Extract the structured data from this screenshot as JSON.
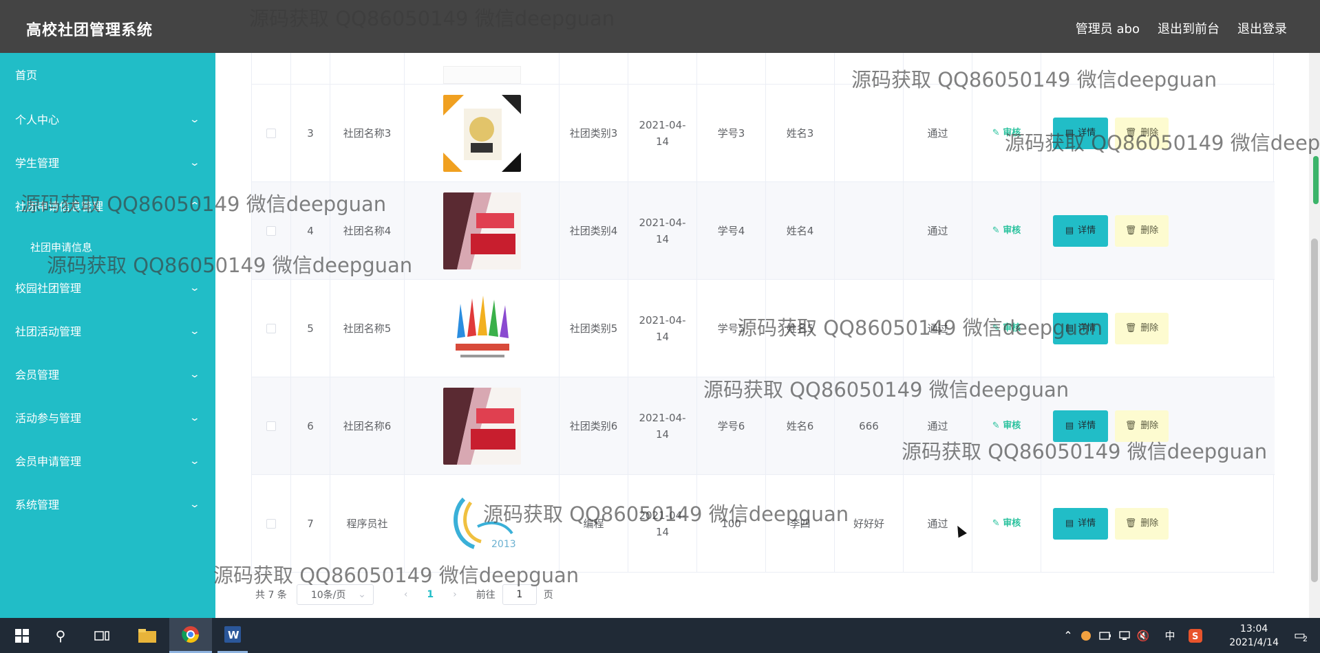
{
  "app": {
    "title": "高校社团管理系统"
  },
  "topbar": {
    "user": "管理员 abo",
    "front": "退出到前台",
    "logout": "退出登录"
  },
  "sidebar": {
    "items": [
      {
        "label": "首页"
      },
      {
        "label": "个人中心"
      },
      {
        "label": "学生管理"
      },
      {
        "label": "社团申请信息管理"
      },
      {
        "label": "社团申请信息"
      },
      {
        "label": "校园社团管理"
      },
      {
        "label": "社团活动管理"
      },
      {
        "label": "会员管理"
      },
      {
        "label": "活动参与管理"
      },
      {
        "label": "会员申请管理"
      },
      {
        "label": "系统管理"
      }
    ]
  },
  "table": {
    "rows": [
      {
        "index": "3",
        "name": "社团名称3",
        "category": "社团类别3",
        "date": "2021-04-14",
        "student_id": "学号3",
        "student_name": "姓名3",
        "reply": "",
        "status": "通过"
      },
      {
        "index": "4",
        "name": "社团名称4",
        "category": "社团类别4",
        "date": "2021-04-14",
        "student_id": "学号4",
        "student_name": "姓名4",
        "reply": "",
        "status": "通过"
      },
      {
        "index": "5",
        "name": "社团名称5",
        "category": "社团类别5",
        "date": "2021-04-14",
        "student_id": "学号5",
        "student_name": "姓名5",
        "reply": "",
        "status": "通过"
      },
      {
        "index": "6",
        "name": "社团名称6",
        "category": "社团类别6",
        "date": "2021-04-14",
        "student_id": "学号6",
        "student_name": "姓名6",
        "reply": "666",
        "status": "通过"
      },
      {
        "index": "7",
        "name": "程序员社",
        "category": "编程",
        "date": "2021-04-14",
        "student_id": "100",
        "student_name": "李四",
        "reply": "好好好",
        "status": "通过"
      }
    ],
    "audit_label": "审核",
    "detail_label": "详情",
    "delete_label": "删除"
  },
  "pagination": {
    "total": "共 7 条",
    "page_size": "10条/页",
    "current": "1",
    "goto_prefix": "前往",
    "goto_value": "1",
    "goto_suffix": "页"
  },
  "taskbar": {
    "time": "13:04",
    "date": "2021/4/14",
    "ime": "中",
    "notifications": "2"
  },
  "watermark": "源码获取 QQ86050149 微信deepguan"
}
